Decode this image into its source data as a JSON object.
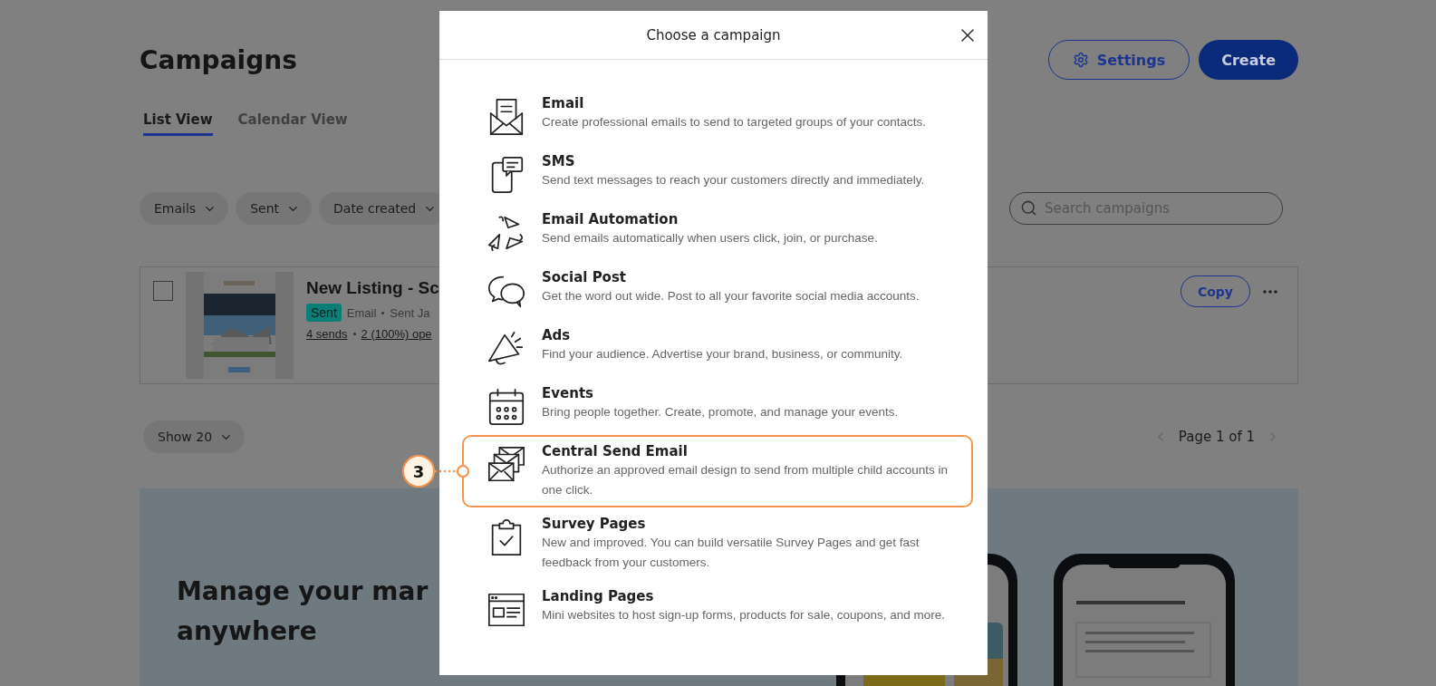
{
  "page": {
    "title": "Campaigns",
    "settings_button": "Settings",
    "create_button": "Create",
    "tabs": [
      {
        "label": "List View",
        "selected": true
      },
      {
        "label": "Calendar View",
        "selected": false
      }
    ],
    "filters": [
      "Emails",
      "Sent",
      "Date created"
    ],
    "search": {
      "placeholder": "Search campaigns"
    },
    "campaign": {
      "checked": false,
      "thumbnail": {
        "kind": "picture"
      },
      "title": "New Listing - Sc",
      "status": "Sent",
      "type": "Email",
      "sent_text": "Sent Ja",
      "stats": [
        "4 sends",
        "2 (100%) ope"
      ],
      "copy_button": "Copy"
    },
    "page_size": "Show 20",
    "pagination": "Page 1 of 1",
    "banner": {
      "heading_lines": [
        "Manage your mar",
        "anywhere"
      ],
      "image": {
        "kind": "picture"
      }
    }
  },
  "dialog": {
    "title": "Choose a campaign",
    "items": [
      {
        "title": "Email",
        "description": "Create professional emails to send to targeted groups of your contacts.",
        "highlighted": false
      },
      {
        "title": "SMS",
        "description": "Send text messages to reach your customers directly and immediately.",
        "highlighted": false
      },
      {
        "title": "Email Automation",
        "description": "Send emails automatically when users click, join, or purchase.",
        "highlighted": false
      },
      {
        "title": "Social Post",
        "description": "Get the word out wide. Post to all your favorite social media accounts.",
        "highlighted": false
      },
      {
        "title": "Ads",
        "description": "Find your audience. Advertise your brand, business, or community.",
        "highlighted": false
      },
      {
        "title": "Events",
        "description": "Bring people together. Create, promote, and manage your events.",
        "highlighted": false
      },
      {
        "title": "Central Send Email",
        "description": "Authorize an approved email design to send from multiple child accounts in one click.",
        "highlighted": true,
        "callout": "3"
      },
      {
        "title": "Survey Pages",
        "description": "New and improved. You can build versatile Survey Pages and get fast feedback from your customers.",
        "highlighted": false
      },
      {
        "title": "Landing Pages",
        "description": "Mini websites to host sign-up forms, products for sale, coupons, and more.",
        "highlighted": false
      }
    ]
  }
}
